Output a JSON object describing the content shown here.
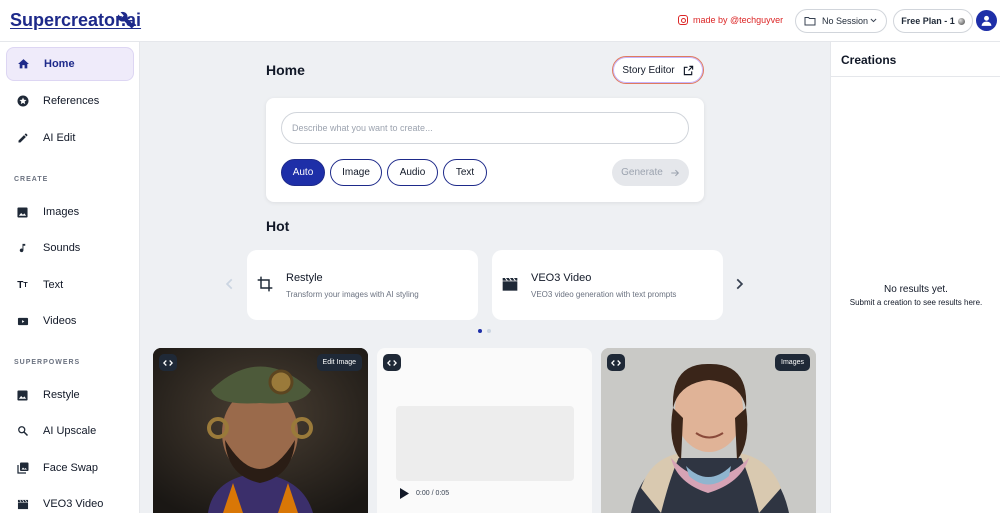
{
  "header": {
    "logo": "Supercreator.ai",
    "made_by": "made by @techguyver",
    "session_label": "No Session",
    "plan_label": "Free Plan - 1"
  },
  "sidebar": {
    "items": [
      {
        "label": "Home",
        "icon": "home-icon"
      },
      {
        "label": "References",
        "icon": "star-circle-icon"
      },
      {
        "label": "AI Edit",
        "icon": "pencil-icon"
      }
    ],
    "create_section": "CREATE",
    "create_items": [
      {
        "label": "Images",
        "icon": "image-icon"
      },
      {
        "label": "Sounds",
        "icon": "music-note-icon"
      },
      {
        "label": "Text",
        "icon": "text-icon"
      },
      {
        "label": "Videos",
        "icon": "video-camera-icon"
      }
    ],
    "superpowers_section": "SUPERPOWERS",
    "superpower_items": [
      {
        "label": "Restyle",
        "icon": "image-icon"
      },
      {
        "label": "AI Upscale",
        "icon": "magnify-icon"
      },
      {
        "label": "Face Swap",
        "icon": "photo-library-icon"
      },
      {
        "label": "VEO3 Video",
        "icon": "clapperboard-icon"
      }
    ]
  },
  "main": {
    "title": "Home",
    "story_editor": "Story Editor",
    "prompt_placeholder": "Describe what you want to create...",
    "modes": [
      "Auto",
      "Image",
      "Audio",
      "Text"
    ],
    "active_mode": "Auto",
    "generate": "Generate",
    "hot_title": "Hot",
    "hot_cards": [
      {
        "title": "Restyle",
        "desc": "Transform your images with AI styling",
        "icon": "crop-icon"
      },
      {
        "title": "VEO3 Video",
        "desc": "VEO3 video generation with text prompts",
        "icon": "clapperboard-icon"
      }
    ],
    "gallery": [
      {
        "tag": "Edit Image"
      },
      {
        "audio_time": "0:00 / 0:05"
      },
      {
        "tag": "Images"
      }
    ]
  },
  "creations": {
    "title": "Creations",
    "empty_title": "No results yet.",
    "empty_desc": "Submit a creation to see results here."
  },
  "colors": {
    "accent": "#1e2fa8",
    "brand_text": "#1e2a8a",
    "made_by": "#dc2626"
  }
}
